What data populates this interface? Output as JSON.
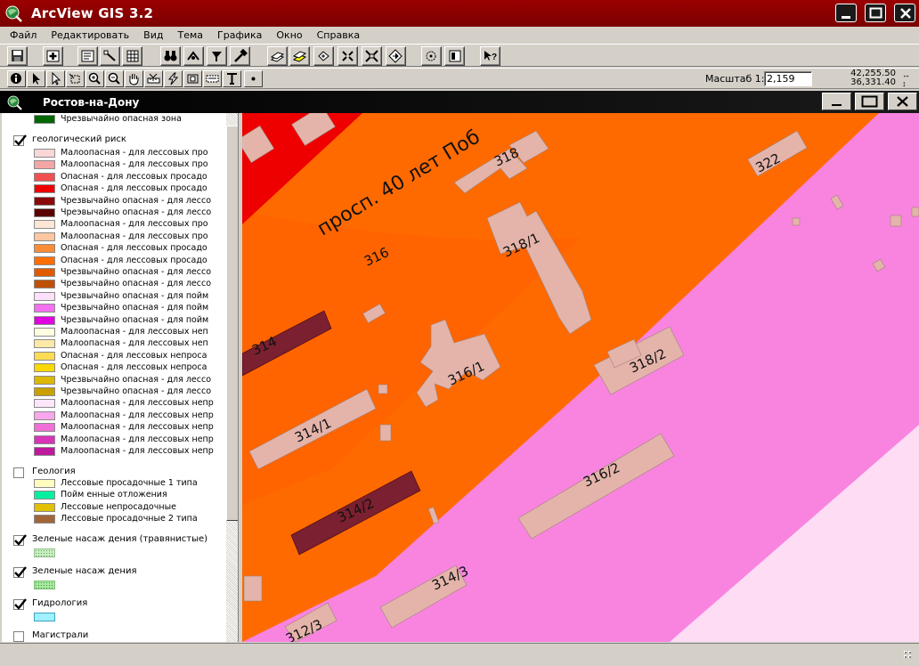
{
  "app": {
    "title": "ArcView GIS 3.2"
  },
  "menu": {
    "items": [
      "Файл",
      "Редактировать",
      "Вид",
      "Тема",
      "Графика",
      "Окно",
      "Справка"
    ]
  },
  "scale": {
    "label": "Масштаб  1:",
    "value": "2,159"
  },
  "coords": {
    "x": "42,255.50",
    "y": "36,331.40"
  },
  "view": {
    "title": "Ростов-на-Дону"
  },
  "legend": {
    "top_item": {
      "label": "Чрезвычайно опасная зона",
      "color": "#006600"
    },
    "risk": {
      "title": "геологический риск",
      "checked": true,
      "classes": [
        {
          "label": "Малоопасная - для лессовых про",
          "color": "#f9d7d7"
        },
        {
          "label": "Малоопасная - для лессовых про",
          "color": "#f4a6a6"
        },
        {
          "label": "Опасная - для лессовых просадо",
          "color": "#f05050"
        },
        {
          "label": "Опасная - для лессовых просадо",
          "color": "#ee0000"
        },
        {
          "label": "Чрезвычайно опасная - для лессо",
          "color": "#8a0a0a"
        },
        {
          "label": "Чреэвычайно опасная - для лессо",
          "color": "#5a0000"
        },
        {
          "label": "Малоопасная - для лессовых про",
          "color": "#fde6d6"
        },
        {
          "label": "Малоопасная - для лессовых про",
          "color": "#fbc6a0"
        },
        {
          "label": "Опасная - для лессовых просадо",
          "color": "#f98c34"
        },
        {
          "label": "Опасная - для лессовых просадо",
          "color": "#ff6f00"
        },
        {
          "label": "Чрезвычайно опасная - для лессо",
          "color": "#e05a00"
        },
        {
          "label": "Чрезвычайно опасная - для лессо",
          "color": "#c05008"
        },
        {
          "label": "Чрезвычайно опасная - для пойм",
          "color": "#fde0fa"
        },
        {
          "label": "Чрезвычайно опасная - для пойм",
          "color": "#f470f0"
        },
        {
          "label": "Чрезвычайно опасная - для пойм",
          "color": "#e000e0"
        },
        {
          "label": "Малоопасная - для лессовых неп",
          "color": "#fffde0"
        },
        {
          "label": "Малоопасная - для лессовых неп",
          "color": "#fde9a6"
        },
        {
          "label": "Опасная - для лессовых непроса",
          "color": "#fddc55"
        },
        {
          "label": "Опасная - для лессовых непроса",
          "color": "#fad800"
        },
        {
          "label": "Чрезвычайно опасная - для лессо",
          "color": "#dcb800"
        },
        {
          "label": "Чрезвычайно опасная - для лессо",
          "color": "#c8a000"
        },
        {
          "label": "Малоопасная - для лессовых непр",
          "color": "#fde6fa"
        },
        {
          "label": "Малоопасная - для лессовых непр",
          "color": "#f9a6ec"
        },
        {
          "label": "Малоопасная - для лессовых непр",
          "color": "#f070d8"
        },
        {
          "label": "Малоопасная - для лессовых непр",
          "color": "#d834b8"
        },
        {
          "label": "Малоопасная - для лессовых непр",
          "color": "#c0189c"
        }
      ]
    },
    "geology": {
      "title": "Геология",
      "checked": false,
      "classes": [
        {
          "label": "Лессовые просадочные 1 типа",
          "color": "#fffcc0"
        },
        {
          "label": "Пойм енные отложения",
          "color": "#00f0a0"
        },
        {
          "label": "Лессовые непросадочные",
          "color": "#e0c000"
        },
        {
          "label": "Лессовые просадочные 2 типа",
          "color": "#a0663a"
        }
      ]
    },
    "green_grass": {
      "title": "Зеленые насаж дения (травянистые)",
      "checked": true,
      "color": "#c8f0c0"
    },
    "green": {
      "title": "Зеленые насаж дения",
      "checked": true,
      "color": "#a8e8a0"
    },
    "hydro": {
      "title": "Гидрология",
      "checked": true,
      "color": "#a0f0ff"
    },
    "roads": {
      "title": "Магистрали",
      "checked": false
    }
  },
  "map": {
    "street_label": "просп. 40 лет Поб",
    "building_labels": [
      "318",
      "322",
      "316",
      "318/1",
      "314",
      "316/1",
      "318/2",
      "314/1",
      "316/2",
      "314/2",
      "314/3",
      "312/3"
    ],
    "colors": {
      "orange_zone": "#ff6a00",
      "pink_zone": "#f984e0",
      "light_pink_zone": "#fddcf4",
      "red_zone": "#ee0000",
      "building": "#e4b4aa",
      "building_dark": "#7a2030"
    }
  }
}
